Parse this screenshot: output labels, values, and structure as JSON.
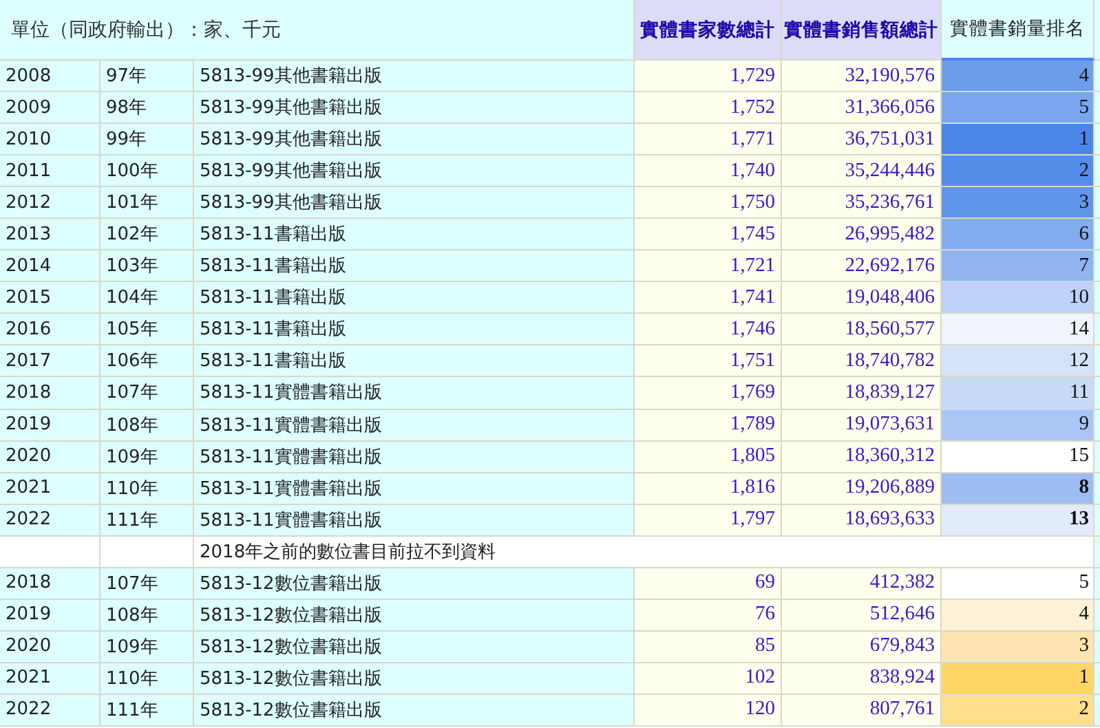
{
  "header": {
    "unit": "單位（同政府輸出）：家、千元",
    "columns": [
      "實體書家數總計",
      "實體書銷售額總計",
      "實體書銷量排名"
    ]
  },
  "rows": [
    {
      "kind": "data",
      "year": "2008",
      "roc_year": "97年",
      "category": "5813-99其他書籍出版",
      "stores": "1,729",
      "sales": "32,190,576",
      "rank": "4",
      "color": "#6d9eeb",
      "bold": false
    },
    {
      "kind": "data",
      "year": "2009",
      "roc_year": "98年",
      "category": "5813-99其他書籍出版",
      "stores": "1,752",
      "sales": "31,366,056",
      "rank": "5",
      "color": "#79a6ee",
      "bold": false
    },
    {
      "kind": "data",
      "year": "2010",
      "roc_year": "99年",
      "category": "5813-99其他書籍出版",
      "stores": "1,771",
      "sales": "36,751,031",
      "rank": "1",
      "color": "#4a86e8",
      "bold": false
    },
    {
      "kind": "data",
      "year": "2011",
      "roc_year": "100年",
      "category": "5813-99其他書籍出版",
      "stores": "1,740",
      "sales": "35,244,446",
      "rank": "2",
      "color": "#558de9",
      "bold": false
    },
    {
      "kind": "data",
      "year": "2012",
      "roc_year": "101年",
      "category": "5813-99其他書籍出版",
      "stores": "1,750",
      "sales": "35,236,761",
      "rank": "3",
      "color": "#6195ea",
      "bold": false
    },
    {
      "kind": "data",
      "year": "2013",
      "roc_year": "102年",
      "category": "5813-11書籍出版",
      "stores": "1,745",
      "sales": "26,995,482",
      "rank": "6",
      "color": "#84adef",
      "bold": false
    },
    {
      "kind": "data",
      "year": "2014",
      "roc_year": "103年",
      "category": "5813-11書籍出版",
      "stores": "1,721",
      "sales": "22,692,176",
      "rank": "7",
      "color": "#8fb4f0",
      "bold": false
    },
    {
      "kind": "data",
      "year": "2015",
      "roc_year": "104年",
      "category": "5813-11書籍出版",
      "stores": "1,741",
      "sales": "19,048,406",
      "rank": "10",
      "color": "#bcd2f7",
      "bold": false
    },
    {
      "kind": "data",
      "year": "2016",
      "roc_year": "105年",
      "category": "5813-11書籍出版",
      "stores": "1,746",
      "sales": "18,560,577",
      "rank": "14",
      "color": "#f0f5fd",
      "bold": false
    },
    {
      "kind": "data",
      "year": "2017",
      "roc_year": "106年",
      "category": "5813-11書籍出版",
      "stores": "1,751",
      "sales": "18,740,782",
      "rank": "12",
      "color": "#d5e2fa",
      "bold": false
    },
    {
      "kind": "data",
      "year": "2018",
      "roc_year": "107年",
      "category": "5813-11實體書籍出版",
      "stores": "1,769",
      "sales": "18,839,127",
      "rank": "11",
      "color": "#c8daf8",
      "bold": false
    },
    {
      "kind": "data",
      "year": "2019",
      "roc_year": "108年",
      "category": "5813-11實體書籍出版",
      "stores": "1,789",
      "sales": "19,073,631",
      "rank": "9",
      "color": "#a9c6f4",
      "bold": false
    },
    {
      "kind": "data",
      "year": "2020",
      "roc_year": "109年",
      "category": "5813-11實體書籍出版",
      "stores": "1,805",
      "sales": "18,360,312",
      "rank": "15",
      "color": "#ffffff",
      "bold": false
    },
    {
      "kind": "data",
      "year": "2021",
      "roc_year": "110年",
      "category": "5813-11實體書籍出版",
      "stores": "1,816",
      "sales": "19,206,889",
      "rank": "8",
      "color": "#9dbdf2",
      "bold": true
    },
    {
      "kind": "data",
      "year": "2022",
      "roc_year": "111年",
      "category": "5813-11實體書籍出版",
      "stores": "1,797",
      "sales": "18,693,633",
      "rank": "13",
      "color": "#e2ebfb",
      "bold": true
    },
    {
      "kind": "note",
      "text": "2018年之前的數位書目前拉不到資料"
    },
    {
      "kind": "data",
      "year": "2018",
      "roc_year": "107年",
      "category": "5813-12數位書籍出版",
      "stores": "69",
      "sales": "412,382",
      "rank": "5",
      "color": "#ffffff",
      "bold": false
    },
    {
      "kind": "data",
      "year": "2019",
      "roc_year": "108年",
      "category": "5813-12數位書籍出版",
      "stores": "76",
      "sales": "512,646",
      "rank": "4",
      "color": "#fff2d9",
      "bold": false
    },
    {
      "kind": "data",
      "year": "2020",
      "roc_year": "109年",
      "category": "5813-12數位書籍出版",
      "stores": "85",
      "sales": "679,843",
      "rank": "3",
      "color": "#ffe5b2",
      "bold": false
    },
    {
      "kind": "data",
      "year": "2021",
      "roc_year": "110年",
      "category": "5813-12數位書籍出版",
      "stores": "102",
      "sales": "838,924",
      "rank": "1",
      "color": "#ffd666",
      "bold": false
    },
    {
      "kind": "data",
      "year": "2022",
      "roc_year": "111年",
      "category": "5813-12數位書籍出版",
      "stores": "120",
      "sales": "807,761",
      "rank": "2",
      "color": "#ffdf8c",
      "bold": false
    }
  ]
}
